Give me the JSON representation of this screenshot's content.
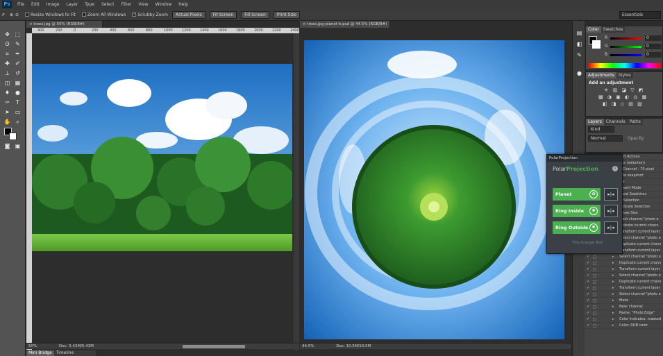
{
  "app": {
    "logo": "Ps"
  },
  "menu": [
    "File",
    "Edit",
    "Image",
    "Layer",
    "Type",
    "Select",
    "Filter",
    "View",
    "Window",
    "Help"
  ],
  "options": {
    "resize_windows": "Resize Windows to Fit",
    "zoom_all": "Zoom All Windows",
    "scrubby": "Scrubby Zoom",
    "actual_pixels": "Actual Pixels",
    "fit_screen": "Fit Screen",
    "fill_screen": "Fill Screen",
    "print_size": "Print Size",
    "workspace": "Essentials"
  },
  "doc_left": {
    "tab": "trees.jpg @ 50% (RGB/8#)",
    "zoom": "50%",
    "doc_size": "Doc: 5.43M/5.43M",
    "ruler": [
      "400",
      "200",
      "0",
      "200",
      "400",
      "600",
      "800",
      "1000",
      "1200",
      "1400",
      "1600",
      "1800",
      "2000",
      "2200",
      "2400"
    ]
  },
  "doc_right": {
    "tab": "trees.jpg-planet-h.psd @ 44.5% (RGB/8#)",
    "zoom": "44.5%",
    "doc_size": "Doc: 10.5M/10.5M"
  },
  "color_panel": {
    "tabs": [
      "Color",
      "Swatches"
    ],
    "labels": [
      "R",
      "G",
      "B"
    ],
    "values": [
      "0",
      "0",
      "0"
    ]
  },
  "adjust_panel": {
    "tabs": [
      "Adjustments",
      "Styles"
    ],
    "title": "Add an adjustment"
  },
  "layers_panel": {
    "tabs": [
      "Layers",
      "Channels",
      "Paths"
    ],
    "kind": "Kind",
    "mode": "Normal",
    "opacity_label": "Opacity:"
  },
  "polar": {
    "header": "PolarProjection",
    "brand_a": "Polar",
    "brand_b": "Projection",
    "buttons": [
      "Planet",
      "Ring Inside",
      "Ring Outside"
    ],
    "credit": "The Orange Box"
  },
  "actions": [
    "ault Actions",
    "rtte (selection)",
    "e Channel - 70 pixel",
    "tate snapshot",
    "ros",
    "onvert Mode",
    "ancel Swatches",
    "el Selection",
    "uplicate Selection",
    "anvas Size",
    "elect channel \"photo e",
    "uplicate current chann",
    "Transform current layer",
    "Select channel \"photo e",
    "Duplicate current chann",
    "Transform current layer",
    "Select channel \"photo e",
    "Duplicate current chann",
    "Transform current layer",
    "Select channel \"photo e",
    "Duplicate current chann",
    "Transform current layer",
    "Select channel \"photo e",
    "Make",
    "New: channel",
    "Name: \"Photo Edge\"",
    "Color Indicates: masked",
    "Color: RGB color"
  ],
  "bottom_tabs": [
    "Mini Bridge",
    "Timeline"
  ],
  "colors": {
    "accent": "#4caf50",
    "brand_blue": "#31a8ff"
  }
}
